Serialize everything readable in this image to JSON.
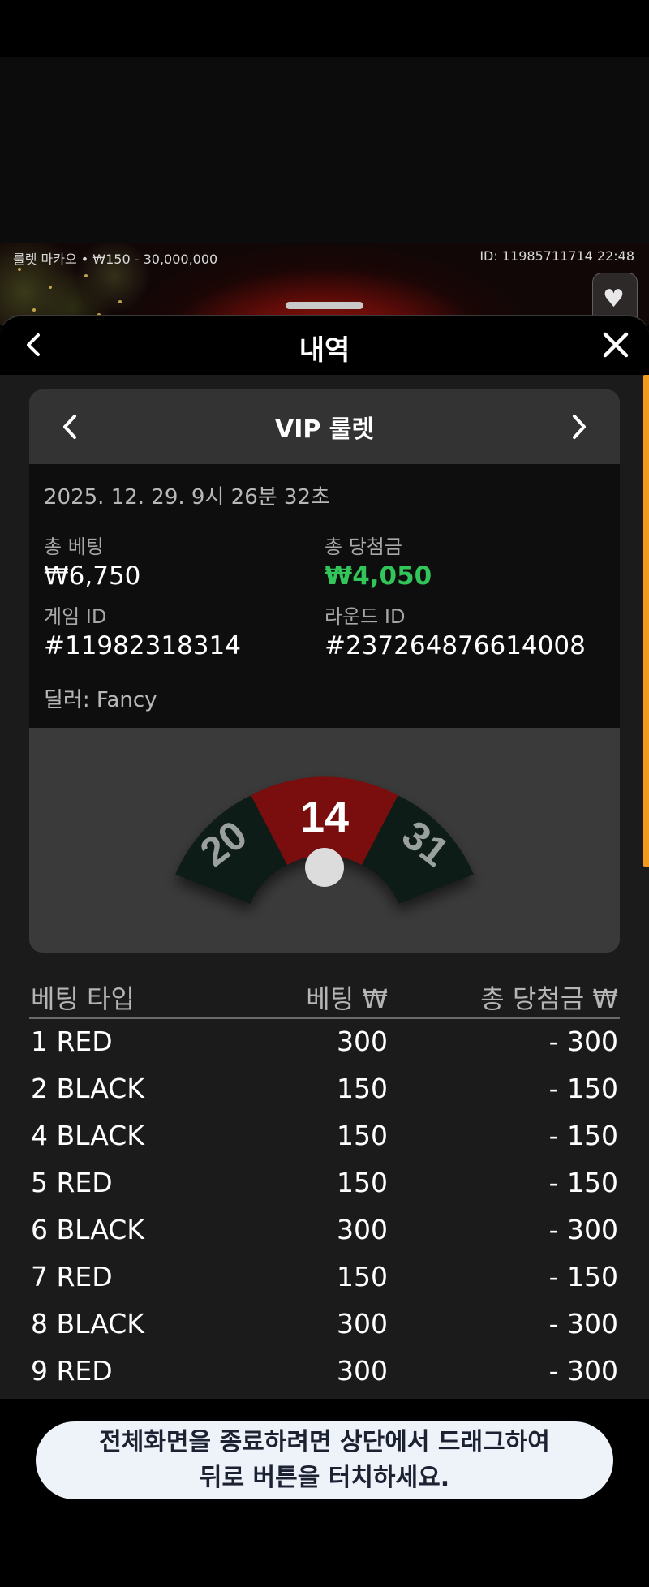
{
  "stream": {
    "table_info": "룰렛 마카오 • ₩150 - 30,000,000",
    "session_info": "ID: 11985711714  22:48"
  },
  "header": {
    "title": "내역",
    "back_icon": "chevron-left-icon",
    "close_icon": "close-icon"
  },
  "card": {
    "title": "VIP 룰렛",
    "datetime": "2025. 12. 29. 9시 26분 32초",
    "total_bet_label": "총 베팅",
    "total_bet_value": "₩6,750",
    "total_win_label": "총 당첨금",
    "total_win_value": "₩4,050",
    "game_id_label": "게임 ID",
    "game_id_value": "#11982318314",
    "round_id_label": "라운드 ID",
    "round_id_value": "#237264876614008",
    "dealer": "딜러: Fancy"
  },
  "wheel": {
    "left_number": "20",
    "center_number": "14",
    "right_number": "31",
    "left_color": "#0b1a17",
    "center_color": "#7a0a08",
    "right_color": "#0b1a17"
  },
  "bets": {
    "headers": {
      "type": "베팅 타입",
      "bet": "베팅 ₩",
      "win": "총 당첨금 ₩"
    },
    "rows": [
      {
        "type": "1 RED",
        "bet": "300",
        "win": "- 300"
      },
      {
        "type": "2 BLACK",
        "bet": "150",
        "win": "- 150"
      },
      {
        "type": "4 BLACK",
        "bet": "150",
        "win": "- 150"
      },
      {
        "type": "5 RED",
        "bet": "150",
        "win": "- 150"
      },
      {
        "type": "6 BLACK",
        "bet": "300",
        "win": "- 300"
      },
      {
        "type": "7 RED",
        "bet": "150",
        "win": "- 150"
      },
      {
        "type": "8 BLACK",
        "bet": "300",
        "win": "- 300"
      },
      {
        "type": "9 RED",
        "bet": "300",
        "win": "- 300"
      }
    ]
  },
  "toast": {
    "line1": "전체화면을 종료하려면 상단에서 드래그하여",
    "line2": "뒤로 버튼을 터치하세요."
  },
  "colors": {
    "accent": "#f29a1b",
    "win": "#31c55a",
    "toast_bg": "#eef2f9"
  }
}
